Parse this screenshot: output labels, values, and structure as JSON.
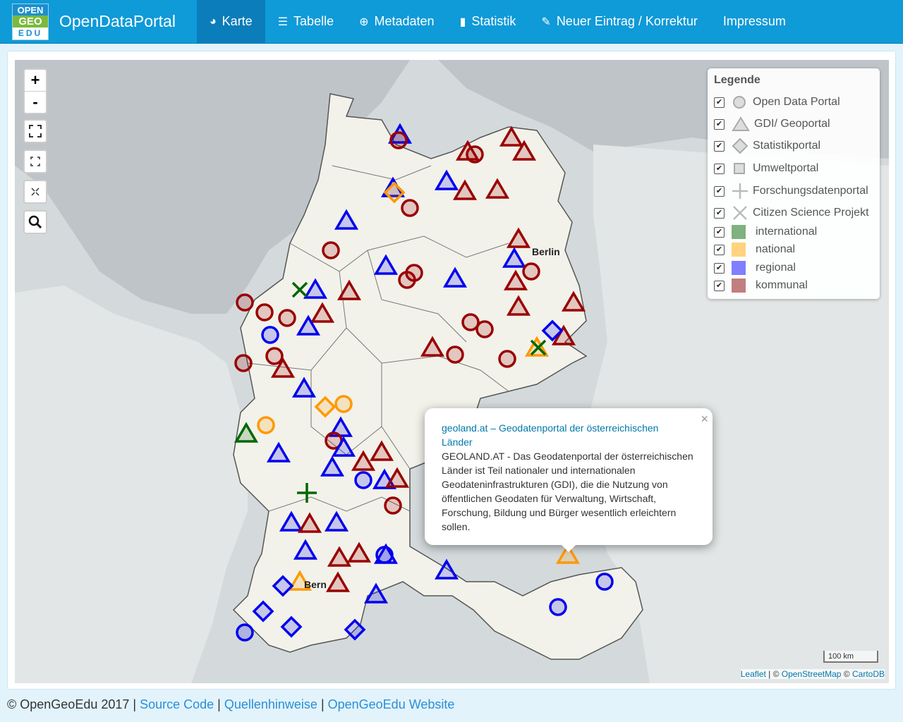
{
  "navbar": {
    "logo": {
      "line1": "OPEN",
      "line2": "GEO",
      "line3": "EDU"
    },
    "brand": "OpenDataPortal",
    "items": [
      {
        "label": "Karte",
        "icon": "globe-icon",
        "glyph": "◕",
        "active": true
      },
      {
        "label": "Tabelle",
        "icon": "list-icon",
        "glyph": "☰",
        "active": false
      },
      {
        "label": "Metadaten",
        "icon": "download-circle-icon",
        "glyph": "⊕",
        "active": false
      },
      {
        "label": "Statistik",
        "icon": "bar-chart-icon",
        "glyph": "▮",
        "active": false
      },
      {
        "label": "Neuer Eintrag / Korrektur",
        "icon": "edit-icon",
        "glyph": "✎",
        "active": false
      },
      {
        "label": "Impressum",
        "icon": "",
        "glyph": "",
        "active": false
      }
    ]
  },
  "map": {
    "zoom_in": "+",
    "zoom_out": "-",
    "city_label": "Berlin",
    "city_label_south": "Bern",
    "legend": {
      "title": "Legende",
      "types": [
        {
          "label": "Open Data Portal",
          "icon": "circle-icon"
        },
        {
          "label": "GDI/ Geoportal",
          "icon": "triangle-icon"
        },
        {
          "label": "Statistikportal",
          "icon": "diamond-icon"
        },
        {
          "label": "Umweltportal",
          "icon": "square-icon"
        },
        {
          "label": "Forschungsdatenportal",
          "icon": "plus-icon"
        },
        {
          "label": "Citizen Science Projekt",
          "icon": "x-icon"
        }
      ],
      "levels": [
        {
          "label": "international",
          "color": "#7fb27f"
        },
        {
          "label": "national",
          "color": "#ffd37f"
        },
        {
          "label": "regional",
          "color": "#7f7fff"
        },
        {
          "label": "kommunal",
          "color": "#c27f7f"
        }
      ]
    },
    "popup": {
      "title": "geoland.at – Geodatenportal der österreichischen Länder",
      "description": "GEOLAND.AT - Das Geodatenportal der österreichischen Länder ist Teil nationaler und internationalen Geodateninfrastrukturen (GDI), die die Nutzung von öffentlichen Geodaten für Verwaltung, Wirtschaft, Forschung, Bildung und Bürger wesentlich erleichtern sollen.",
      "close": "×"
    },
    "scale": "100 km",
    "attribution": {
      "leaflet": "Leaflet",
      "sep1": " | © ",
      "osm": "OpenStreetMap",
      "sep2": " © ",
      "carto": "CartoDB"
    }
  },
  "footer": {
    "copyright": "© OpenGeoEdu 2017",
    "sep": " | ",
    "links": [
      "Source Code",
      "Quellenhinweise",
      "OpenGeoEdu Website"
    ]
  },
  "marker_colors": {
    "kommunal": "#990000",
    "regional": "#0000ee",
    "national": "#ff9900",
    "international": "#006600"
  }
}
